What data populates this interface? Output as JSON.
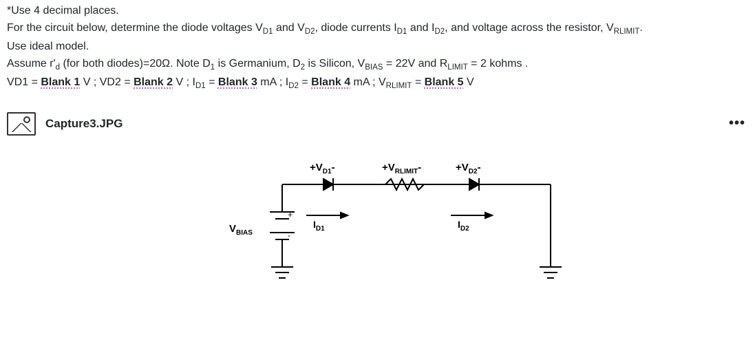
{
  "prompt": {
    "line1_prefix": "*Use 4 decimal places.",
    "line2_a": "For the circuit below, determine the diode voltages V",
    "line2_b": " and V",
    "line2_c": ",  diode currents I",
    "line2_d": " and I",
    "line2_e": ", and voltage across the resistor, V",
    "line2_f": ".",
    "sub_D1": "D1",
    "sub_D2": "D2",
    "sub_RLIMIT": "RLIMIT",
    "line3": "Use ideal model.",
    "line4_a": "Assume r'",
    "line4_sub_d": "d",
    "line4_b": " (for both diodes)=20Ω. Note D",
    "line4_sub_1": "1",
    "line4_c": " is Germanium, D",
    "line4_sub_2": "2",
    "line4_d": " is Silicon, V",
    "line4_sub_BIAS": "BIAS",
    "line4_e": " = 22V and R",
    "line4_sub_LIMIT": "LIMIT",
    "line4_f": " = 2 kohms .",
    "ans_vd1_pre": "VD1 = ",
    "ans_vd1_blank": "Blank 1",
    "ans_vd1_unit": " V",
    "ans_sep": " ; ",
    "ans_vd2_pre": "VD2 = ",
    "ans_vd2_blank": "Blank 2",
    "ans_vd2_unit": " V",
    "ans_id1_pre": "I",
    "ans_id1_blank": "Blank 3",
    "ans_id1_unit": " mA",
    "ans_id2_pre": "I",
    "ans_id2_blank": "Blank 4",
    "ans_id2_unit": " mA",
    "ans_id_eq": " = ",
    "ans_vr_pre": "V",
    "ans_vr_sub_eq": " = ",
    "ans_vr_blank": "Blank 5",
    "ans_vr_unit": " V"
  },
  "attachment": {
    "filename": "Capture3.JPG",
    "menu_glyph": "•••"
  },
  "circuit": {
    "vbias": "V",
    "vbias_sub": "BIAS",
    "vd1_plus": "+V",
    "vd1_sub": "D1",
    "vd1_minus": "-",
    "vrlimit_plus": "+V",
    "vrlimit_sub": "RLIMIT",
    "vrlimit_minus": "-",
    "vd2_plus": "+V",
    "vd2_sub": "D2",
    "vd2_minus": "-",
    "id1": "I",
    "id1_sub": "D1",
    "id2": "I",
    "id2_sub": "D2",
    "src_plus": "+",
    "src_minus": "-"
  }
}
